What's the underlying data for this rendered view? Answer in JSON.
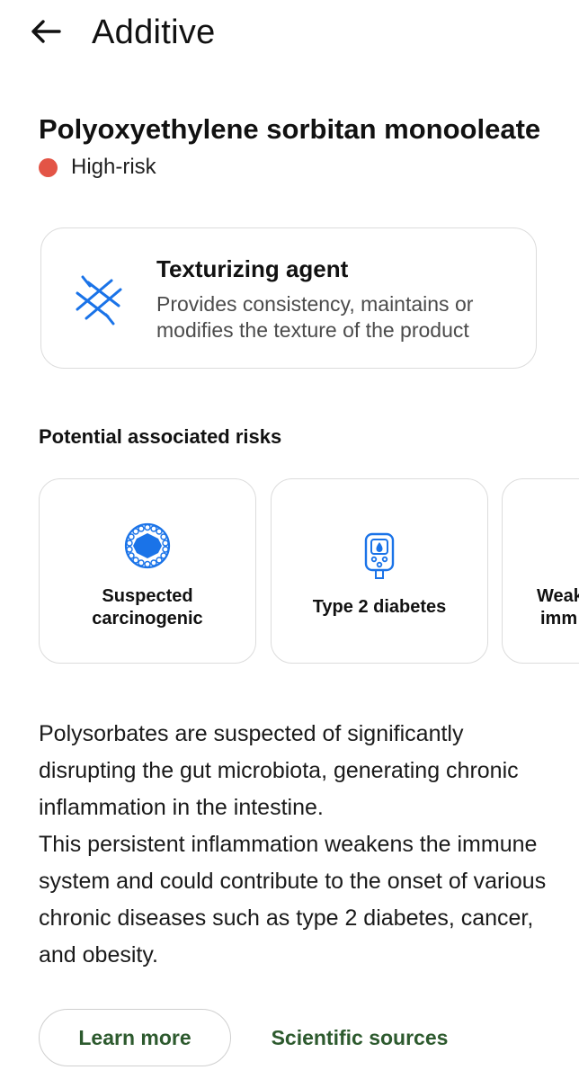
{
  "header": {
    "title": "Additive"
  },
  "additive": {
    "name": "Polyoxyethylene sorbitan monooleate",
    "risk_level": "High-risk",
    "risk_color": "#e35446"
  },
  "function": {
    "title": "Texturizing agent",
    "description": "Provides consistency, maintains or modifies the texture of the product",
    "icon": "texture-icon",
    "icon_color": "#1a73e8"
  },
  "risks": {
    "heading": "Potential associated risks",
    "items": [
      {
        "label": "Suspected carcinogenic",
        "icon": "cell-icon"
      },
      {
        "label": "Type 2 diabetes",
        "icon": "glucose-meter-icon"
      },
      {
        "label": "Weak imm",
        "icon": "immune-icon"
      }
    ]
  },
  "description": {
    "paragraph1": "Polysorbates are suspected of significantly disrupting the gut microbiota, generating chronic inflammation in the intestine.",
    "paragraph2": "This persistent inflammation weakens the immune system and could contribute to the onset of various chronic diseases such as type 2 diabetes, cancer, and obesity."
  },
  "actions": {
    "learn_more": "Learn more",
    "scientific_sources": "Scientific sources"
  },
  "colors": {
    "accent_green": "#2d5a2e",
    "icon_blue": "#1a73e8"
  }
}
